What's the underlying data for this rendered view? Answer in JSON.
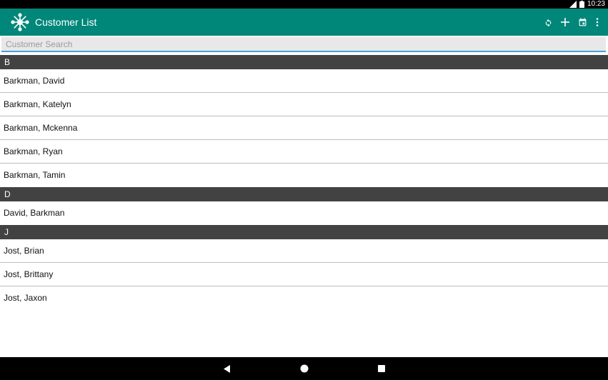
{
  "status_bar": {
    "time": "10:23"
  },
  "app_bar": {
    "title": "Customer List",
    "actions": [
      "refresh-icon",
      "add-icon",
      "calendar-icon",
      "more-vert-icon"
    ]
  },
  "search": {
    "placeholder": "Customer Search",
    "value": ""
  },
  "sections": [
    {
      "header": "B",
      "items": [
        "Barkman, David",
        "Barkman, Katelyn",
        "Barkman, Mckenna",
        "Barkman, Ryan",
        "Barkman, Tamin"
      ]
    },
    {
      "header": "D",
      "items": [
        "David, Barkman"
      ]
    },
    {
      "header": "J",
      "items": [
        "Jost, Brian",
        "Jost, Brittany",
        "Jost, Jaxon"
      ]
    }
  ],
  "colors": {
    "app_bar": "#00877a",
    "section_header": "#424242",
    "search_underline": "#4aa0d8"
  },
  "nav_bar": {
    "buttons": [
      "back-icon",
      "home-icon",
      "recents-icon"
    ]
  }
}
